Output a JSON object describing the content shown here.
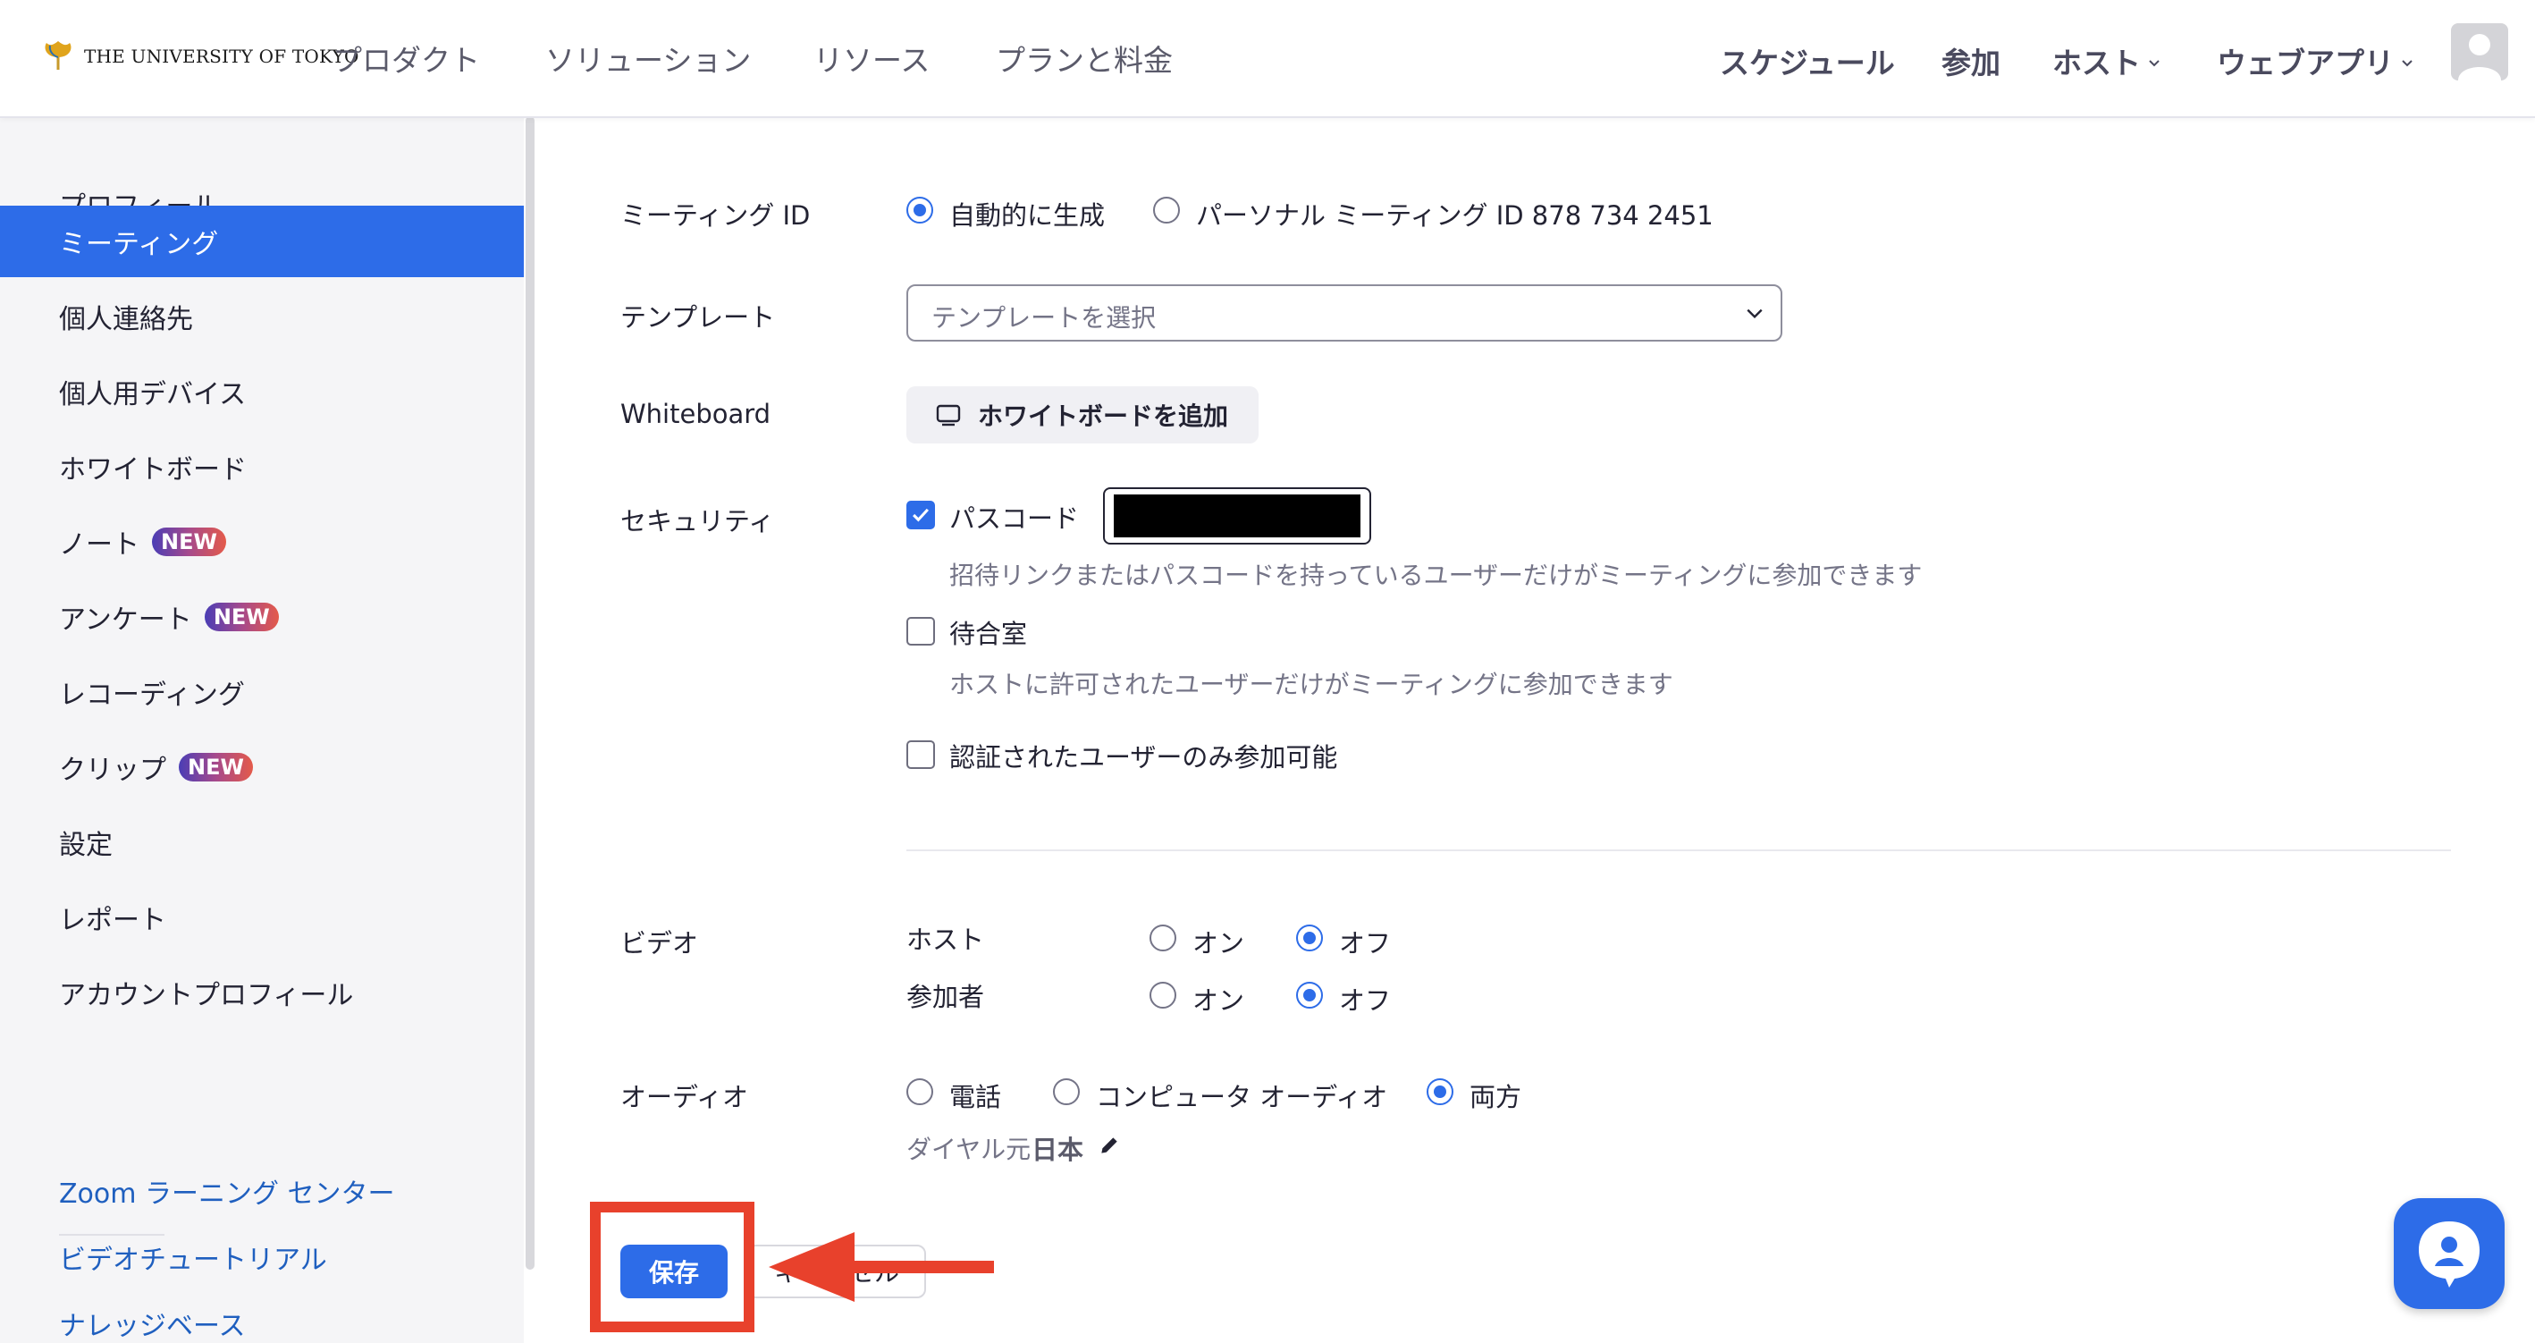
{
  "header": {
    "logo_text": "THE UNIVERSITY OF TOKYO",
    "nav_left": [
      "プロダクト",
      "ソリューション",
      "リソース",
      "プランと料金"
    ],
    "nav_right": {
      "schedule": "スケジュール",
      "join": "参加",
      "host": "ホスト",
      "webapp": "ウェブアプリ"
    }
  },
  "sidebar": {
    "items": [
      {
        "label": "プロフィール"
      },
      {
        "label": "ミーティング",
        "active": true
      },
      {
        "label": "個人連絡先"
      },
      {
        "label": "個人用デバイス"
      },
      {
        "label": "ホワイトボード"
      },
      {
        "label": "ノート",
        "badge": "NEW"
      },
      {
        "label": "アンケート",
        "badge": "NEW"
      },
      {
        "label": "レコーディング"
      },
      {
        "label": "クリップ",
        "badge": "NEW"
      },
      {
        "label": "設定"
      },
      {
        "label": "レポート"
      },
      {
        "label": "アカウントプロフィール"
      }
    ],
    "links": [
      "Zoom ラーニング センター",
      "ビデオチュートリアル",
      "ナレッジベース"
    ]
  },
  "form": {
    "meeting_id": {
      "label": "ミーティング ID",
      "auto": "自動的に生成",
      "personal": "パーソナル ミーティング ID 878 734 2451"
    },
    "template": {
      "label": "テンプレート",
      "placeholder": "テンプレートを選択"
    },
    "whiteboard": {
      "label": "Whiteboard",
      "button": "ホワイトボードを追加"
    },
    "security": {
      "label": "セキュリティ",
      "passcode": "パスコード",
      "passcode_hint": "招待リンクまたはパスコードを持っているユーザーだけがミーティングに参加できます",
      "waiting_room": "待合室",
      "waiting_hint": "ホストに許可されたユーザーだけがミーティングに参加できます",
      "auth_only": "認証されたユーザーのみ参加可能"
    },
    "video": {
      "label": "ビデオ",
      "host": "ホスト",
      "participant": "参加者",
      "on": "オン",
      "off": "オフ"
    },
    "audio": {
      "label": "オーディオ",
      "phone": "電話",
      "computer": "コンピュータ オーディオ",
      "both": "両方",
      "dial_from": "ダイヤル元",
      "dial_country": "日本"
    },
    "save": "保存",
    "cancel": "キャンセル"
  },
  "colors": {
    "accent": "#2d6ce8",
    "highlight": "#e8412c"
  }
}
